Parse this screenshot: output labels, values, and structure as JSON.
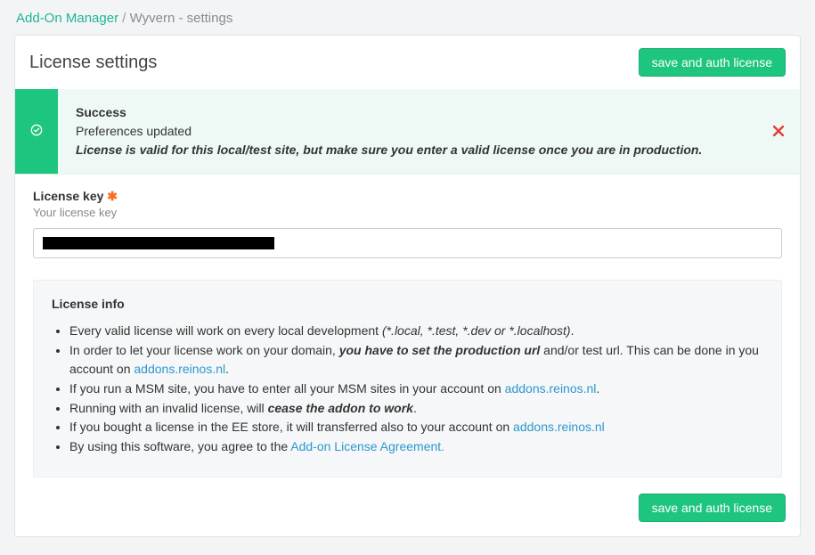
{
  "breadcrumb": {
    "root": "Add-On Manager",
    "current": "Wyvern - settings"
  },
  "header": {
    "title": "License settings",
    "save_button": "save and auth license"
  },
  "alert": {
    "title": "Success",
    "message": "Preferences updated",
    "note": "License is valid for this local/test site, but make sure you enter a valid license once you are in production."
  },
  "form": {
    "license_label": "License key",
    "license_hint": "Your license key",
    "license_value": ""
  },
  "info": {
    "heading": "License info",
    "items": [
      {
        "pre": "Every valid license will work on every local development ",
        "emph": "(*.local, *.test, *.dev or *.localhost)",
        "post": "."
      },
      {
        "pre": "In order to let your license work on your domain, ",
        "strong": "you have to set the production url",
        "post": " and/or test url. This can be done in you account on ",
        "link": "addons.reinos.nl",
        "after": "."
      },
      {
        "pre": "If you run a MSM site, you have to enter all your MSM sites in your account on ",
        "link": "addons.reinos.nl",
        "after": "."
      },
      {
        "pre": "Running with an invalid license, will ",
        "strong_em": "cease the addon to work",
        "after": "."
      },
      {
        "pre": "If you bought a license in the EE store, it will transferred also to your account on ",
        "link": "addons.reinos.nl"
      },
      {
        "pre": "By using this software, you agree to the ",
        "link": "Add-on License Agreement."
      }
    ]
  },
  "footer": {
    "save_button": "save and auth license"
  }
}
